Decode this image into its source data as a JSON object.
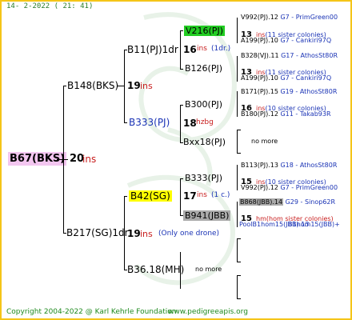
{
  "header": {
    "date": "14-  2-2022 (  21:  41)"
  },
  "root": {
    "name": "B67(BKS)",
    "count": "20",
    "unit": "ins"
  },
  "gen1": [
    {
      "name": "B148(BKS)",
      "count": "19",
      "unit": "ins"
    },
    {
      "name": "B217(SG)1dr",
      "count": "19",
      "unit": "ins",
      "note": "(Only one drone)"
    }
  ],
  "gen2": [
    {
      "name": "B11(PJ)1dr",
      "count": "16",
      "unit": "ins",
      "note": "(1dr.)"
    },
    {
      "name": "B333(PJ)",
      "count": "18",
      "unit": "hzbg"
    },
    {
      "name": "B42(SG)",
      "count": "17",
      "unit": "ins",
      "note": "(1 c.)",
      "highlight": "#ffff00"
    },
    {
      "name": "B36.18(MH)",
      "note": "no more"
    }
  ],
  "gen3": [
    {
      "name": "V216(PJ)",
      "highlight": "#22cc22"
    },
    {
      "name": "B126(PJ)"
    },
    {
      "name": "B300(PJ)"
    },
    {
      "name": "Bxx18(PJ)",
      "note": "no more"
    },
    {
      "name": "B333(PJ)"
    },
    {
      "name": "B941(JBB)",
      "highlight": "#aaaaaa"
    }
  ],
  "gen4": [
    {
      "top": "V992(PJ).12",
      "code": "G7",
      "source": "PrimGreen00",
      "count": "13",
      "unit": "ins",
      "sub": "(11 sister colonies)",
      "bottom": "A199(PJ).10",
      "code2": "G7",
      "source2": "Cankiri97Q"
    },
    {
      "top": "B328(VJ).11",
      "code": "G17",
      "source": "AthosSt80R",
      "count": "13",
      "unit": "ins",
      "sub": "(11 sister colonies)",
      "bottom": "A199(PJ).10",
      "code2": "G7",
      "source2": "Cankiri97Q"
    },
    {
      "top": "B171(PJ).15",
      "code": "G19",
      "source": "AthosSt80R",
      "count": "16",
      "unit": "ins",
      "sub": "(10 sister colonies)",
      "bottom": "B180(PJ).12",
      "code2": "G11",
      "source2": "Takab93R"
    },
    {
      "note": "no more"
    },
    {
      "top": "B113(PJ).13",
      "code": "G18",
      "source": "AthosSt80R",
      "count": "15",
      "unit": "ins",
      "sub": "(10 sister colonies)",
      "bottom": "V992(PJ).12",
      "code2": "G7",
      "source2": "PrimGreen00"
    },
    {
      "top": "B868(JBB).14",
      "code": "G29",
      "source": "Sinop62R",
      "count": "15",
      "unit": "hm",
      "sub": "(hom sister colonies)",
      "bottom": "PoolB1hom15(JBB).13",
      "overlap": "B1hom15(JBB)+"
    }
  ],
  "footer": {
    "copyright": "Copyright 2004-2022 @ Karl Kehrle Foundation",
    "url": "www.pedigreeapis.org"
  },
  "colors": {
    "frame": "#f5c518",
    "root_bg": "#f3c6f0",
    "header_text": "#2a7d2a",
    "count_unit": "#c81e1e",
    "source": "#1a33b5"
  }
}
